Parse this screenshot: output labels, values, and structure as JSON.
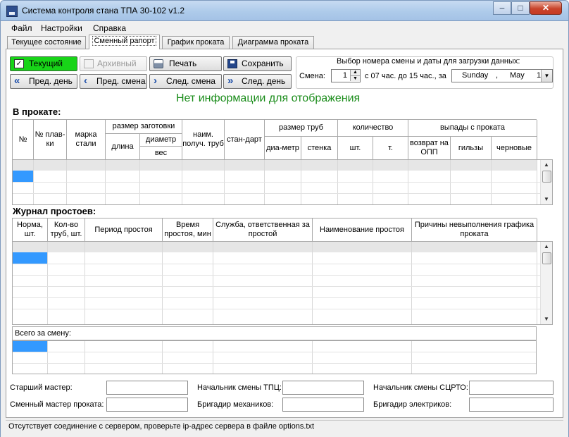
{
  "window": {
    "title": "Система контроля стана ТПА 30-102 v1.2"
  },
  "menu": [
    "Файл",
    "Настройки",
    "Справка"
  ],
  "tabs": [
    "Текущее состояние",
    "Сменный рапорт",
    "График проката",
    "Диаграмма проката"
  ],
  "buttons": {
    "current": "Текущий",
    "archive": "Архивный",
    "print": "Печать",
    "save": "Сохранить",
    "prev_day": "Пред. день",
    "prev_shift": "Пред. смена",
    "next_shift": "След. смена",
    "next_day": "След. день"
  },
  "shift_select": {
    "title": "Выбор номера смены и даты для загрузки данных:",
    "shift_label": "Смена:",
    "shift_value": "1",
    "time_text": "с 07 час. до 15 час., за",
    "date_day": "Sunday",
    "date_sep": ",",
    "date_month": "May",
    "date_num": "1"
  },
  "message": "Нет информации для отображения",
  "rolling": {
    "title": "В прокате:",
    "headers": {
      "num": "№",
      "melt": "№ плав-ки",
      "steel": "марка стали",
      "billet": "размер заготовки",
      "length": "длина",
      "diameter": "диаметр",
      "weight": "вес",
      "pipe_name": "наим. получ. труб",
      "standard": "стан-дарт",
      "pipe_size": "размер труб",
      "pipe_diam": "диа-метр",
      "wall": "стенка",
      "quantity": "количество",
      "pcs": "шт.",
      "tons": "т.",
      "dropouts": "выпады с проката",
      "return": "возврат на ОПП",
      "sleeves": "гильзы",
      "rough": "черновые"
    }
  },
  "downtime": {
    "title": "Журнал простоев:",
    "headers": [
      "Норма, шт.",
      "Кол-во труб, шт.",
      "Период простоя",
      "Время простоя, мин",
      "Служба, ответственная за простой",
      "Наименование простоя",
      "Причины невыполнения графика проката"
    ]
  },
  "total": {
    "label": "Всего за смену:"
  },
  "signatures": {
    "senior_master": "Старший мастер:",
    "shift_master": "Сменный мастер проката:",
    "tpc_chief": "Начальник смены ТПЦ:",
    "foreman_mech": "Бригадир механиков:",
    "scrto_chief": "Начальник смены СЦРТО:",
    "foreman_elec": "Бригадир электриков:"
  },
  "status_bar": "Отсутствует соединение с сервером, проверьте ip-адрес сервера в файле options.txt",
  "colors": {
    "accent_green": "#18d418",
    "selection": "#3399ff",
    "message_green": "#1a8c1a"
  }
}
